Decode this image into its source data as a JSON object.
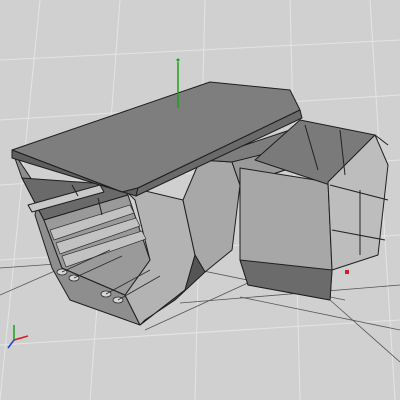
{
  "viewport": {
    "projection": "perspective",
    "background_color": "#d0d0d0",
    "grid_color": "#e6e6e6",
    "edge_color": "#202020"
  },
  "model": {
    "type": "hexagonal-corridor-module",
    "shading": "flat-gray-with-edges",
    "face_colors": {
      "top": "#7f7f7f",
      "side": "#a6a6a6",
      "dark": "#5a5a5a",
      "interior": "#bcbcbc"
    }
  },
  "axis_triad": {
    "x_color": "#d02020",
    "y_color": "#20a020",
    "z_color": "#2040d0"
  },
  "pivot_gizmo": {
    "colors": [
      "#20a020",
      "#d02020"
    ]
  }
}
